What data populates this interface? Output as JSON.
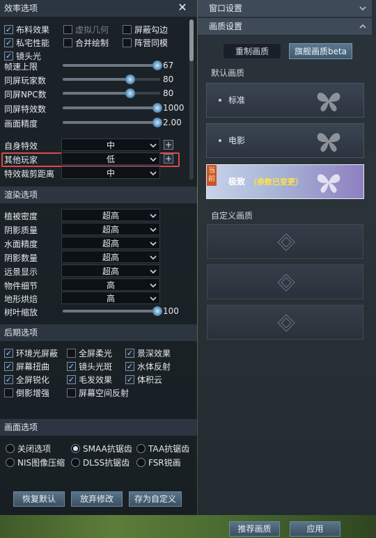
{
  "left_panel": {
    "efficiency_section": {
      "title": "效率选项",
      "close_icon": "close-icon"
    },
    "efficiency_checkboxes": [
      {
        "label": "布料效果",
        "checked": true,
        "enabled": true
      },
      {
        "label": "虚拟几何",
        "checked": false,
        "enabled": false
      },
      {
        "label": "屏蔽勾边",
        "checked": false,
        "enabled": true
      },
      {
        "label": "私宅性能",
        "checked": true,
        "enabled": true
      },
      {
        "label": "合并绘制",
        "checked": false,
        "enabled": true
      },
      {
        "label": "阵营同模",
        "checked": false,
        "enabled": true
      },
      {
        "label": "镜头光",
        "checked": true,
        "enabled": true
      }
    ],
    "sliders": [
      {
        "label": "帧速上限",
        "value": "67",
        "fraction": 1.0
      },
      {
        "label": "同屏玩家数",
        "value": "80",
        "fraction": 0.71
      },
      {
        "label": "同屏NPC数",
        "value": "80",
        "fraction": 0.71
      },
      {
        "label": "同屏特效数",
        "value": "1000",
        "fraction": 1.0
      },
      {
        "label": "画面精度",
        "value": "2.00",
        "fraction": 1.0
      }
    ],
    "effect_dropdowns": [
      {
        "label": "自身特效",
        "value": "中",
        "has_plus": true
      },
      {
        "label": "其他玩家",
        "value": "低",
        "has_plus": true,
        "highlighted": true
      },
      {
        "label": "特效裁剪距离",
        "value": "中",
        "has_plus": false
      }
    ],
    "render_section": {
      "title": "渲染选项"
    },
    "render_dropdowns": [
      {
        "label": "植被密度",
        "value": "超高"
      },
      {
        "label": "阴影质量",
        "value": "超高"
      },
      {
        "label": "水面精度",
        "value": "超高"
      },
      {
        "label": "阴影数量",
        "value": "超高"
      },
      {
        "label": "远景显示",
        "value": "超高"
      },
      {
        "label": "物件细节",
        "value": "高"
      },
      {
        "label": "地形烘焙",
        "value": "高"
      }
    ],
    "tree_scale": {
      "label": "树叶缩放",
      "value": "100",
      "fraction": 1.0
    },
    "post_section": {
      "title": "后期选项"
    },
    "post_checkboxes": [
      {
        "label": "环境光屏蔽",
        "checked": true
      },
      {
        "label": "全屏柔光",
        "checked": false
      },
      {
        "label": "景深效果",
        "checked": true
      },
      {
        "label": "屏幕扭曲",
        "checked": true
      },
      {
        "label": "镜头光斑",
        "checked": true
      },
      {
        "label": "水体反射",
        "checked": true
      },
      {
        "label": "全屏锐化",
        "checked": true
      },
      {
        "label": "毛发效果",
        "checked": true
      },
      {
        "label": "体积云",
        "checked": true
      },
      {
        "label": "倒影增强",
        "checked": false
      },
      {
        "label": "屏幕空间反射",
        "checked": false
      }
    ],
    "picture_section": {
      "title": "画面选项"
    },
    "radios": [
      {
        "label": "关闭选项",
        "selected": false
      },
      {
        "label": "SMAA抗锯齿",
        "selected": true
      },
      {
        "label": "TAA抗锯齿",
        "selected": false
      },
      {
        "label": "NIS图像压缩",
        "selected": false
      },
      {
        "label": "DLSS抗锯齿",
        "selected": false
      },
      {
        "label": "FSR锐画",
        "selected": false
      }
    ],
    "buttons": {
      "restore": "恢复默认",
      "discard": "放弃修改",
      "save_custom": "存为自定义"
    }
  },
  "right_panel": {
    "window_settings": "窗口设置",
    "quality_settings": "画质设置",
    "tabs": {
      "custom": "重制画质",
      "flagship": "旗舰画质beta"
    },
    "default_quality_label": "默认画质",
    "presets": [
      {
        "label": "标准",
        "selected": false
      },
      {
        "label": "电影",
        "selected": false
      },
      {
        "label": "极致",
        "selected": true,
        "tag": "（参数已变更）",
        "badge": "当前"
      }
    ],
    "custom_quality_label": "自定义画质",
    "custom_slots": 3
  },
  "bottom_buttons": {
    "recommend": "推荐画质",
    "apply": "应用"
  },
  "colors": {
    "accent": "#6d8aa0",
    "highlight_border": "#e04848",
    "tag_yellow": "#ffe04a"
  }
}
